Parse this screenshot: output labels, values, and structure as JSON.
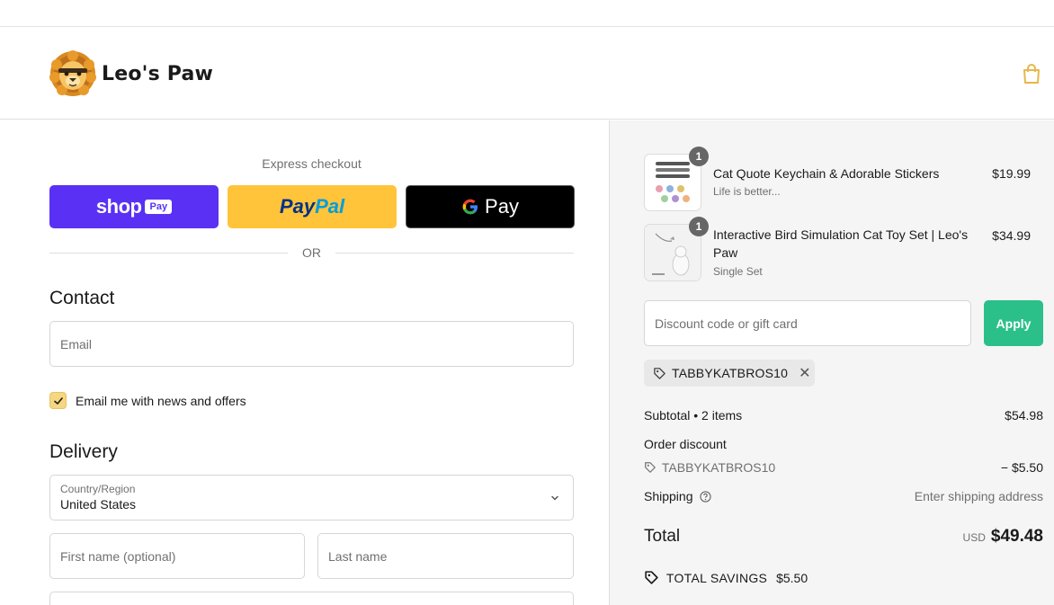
{
  "brand": {
    "name": "Leo's Paw"
  },
  "express": {
    "title": "Express checkout",
    "shop_word": "shop",
    "shop_pay": "Pay",
    "paypal_pay": "Pay",
    "paypal_pal": "Pal",
    "gpay_label": "Pay",
    "or_text": "OR"
  },
  "contact": {
    "title": "Contact",
    "email_placeholder": "Email",
    "newsletter_label": "Email me with news and offers",
    "newsletter_checked": true
  },
  "delivery": {
    "title": "Delivery",
    "country_label": "Country/Region",
    "country_value": "United States",
    "first_name_placeholder": "First name (optional)",
    "last_name_placeholder": "Last name"
  },
  "cart": {
    "items": [
      {
        "name": "Cat Quote Keychain & Adorable Stickers",
        "variant": "Life is better...",
        "price": "$19.99",
        "qty": "1"
      },
      {
        "name": "Interactive Bird Simulation Cat Toy Set | Leo's Paw",
        "variant": "Single Set",
        "price": "$34.99",
        "qty": "1"
      }
    ]
  },
  "discount": {
    "placeholder": "Discount code or gift card",
    "apply_label": "Apply",
    "applied_code": "TABBYKATBROS10"
  },
  "summary": {
    "subtotal_label": "Subtotal • 2 items",
    "subtotal_value": "$54.98",
    "order_discount_label": "Order discount",
    "discount_code": "TABBYKATBROS10",
    "discount_value": "− $5.50",
    "shipping_label": "Shipping",
    "shipping_value": "Enter shipping address",
    "total_label": "Total",
    "total_currency": "USD",
    "total_value": "$49.48",
    "savings_label": "TOTAL SAVINGS",
    "savings_value": "$5.50"
  },
  "colors": {
    "shop_pay": "#5a31f4",
    "paypal": "#ffc439",
    "apply": "#2bc08a",
    "checkbox": "#f5d682"
  }
}
